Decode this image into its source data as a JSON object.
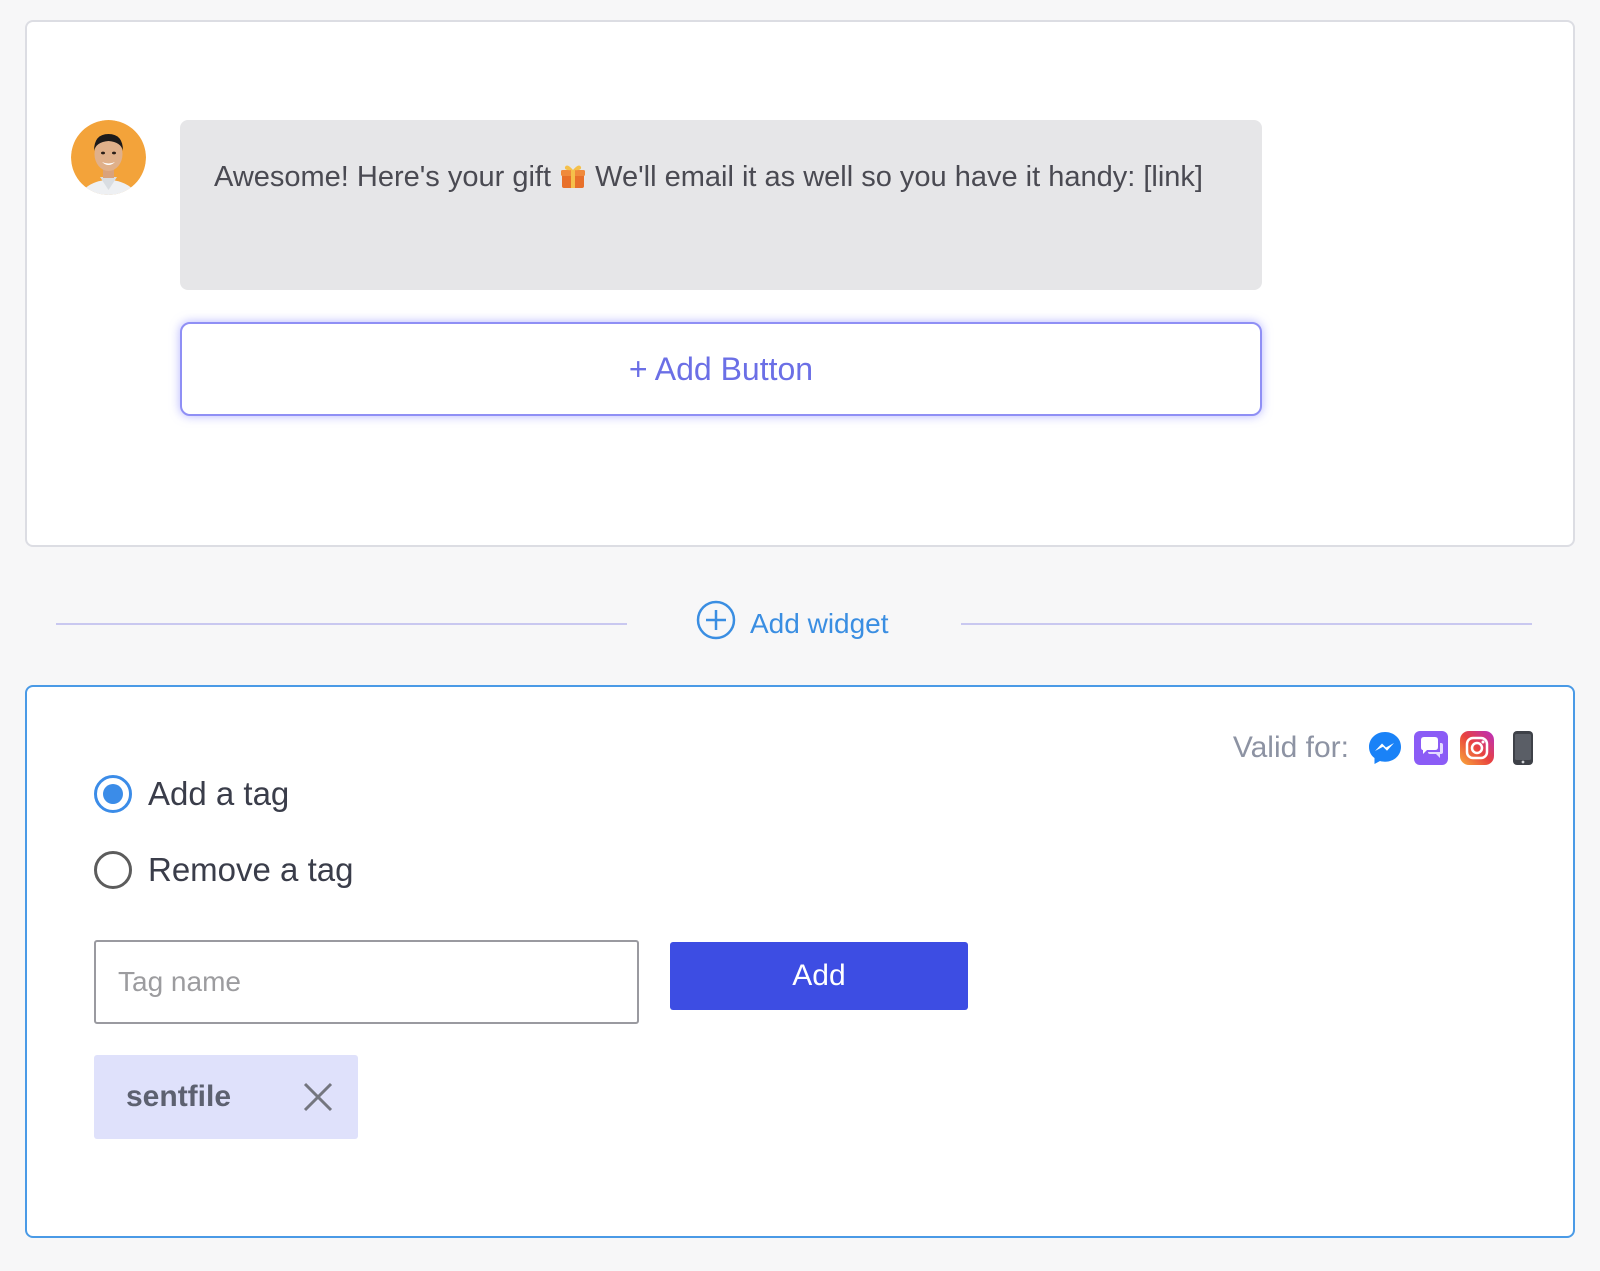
{
  "message": {
    "avatar_alt": "sender-avatar",
    "text_before_emoji": "Awesome! Here's your gift ",
    "text_after_emoji": " We'll email it as well so you have it handy: [link]",
    "emoji_icon": "gift-icon",
    "add_button_label": "+ Add Button"
  },
  "widget_divider": {
    "add_widget_label": "Add widget",
    "icon": "plus-circle-icon"
  },
  "tag_widget": {
    "valid_for_label": "Valid for:",
    "channels": [
      "messenger-icon",
      "chat-icon",
      "instagram-icon",
      "phone-icon"
    ],
    "options": [
      {
        "label": "Add a tag",
        "checked": true
      },
      {
        "label": "Remove a tag",
        "checked": false
      }
    ],
    "input_placeholder": "Tag name",
    "input_value": "",
    "add_label": "Add",
    "tags": [
      {
        "label": "sentfile",
        "remove_icon": "close-icon"
      }
    ]
  },
  "colors": {
    "accent_blue": "#3b8ce8",
    "primary_button": "#3d4de3",
    "add_button_text": "#6b6fe6",
    "tag_chip_bg": "#dfe1fb"
  }
}
